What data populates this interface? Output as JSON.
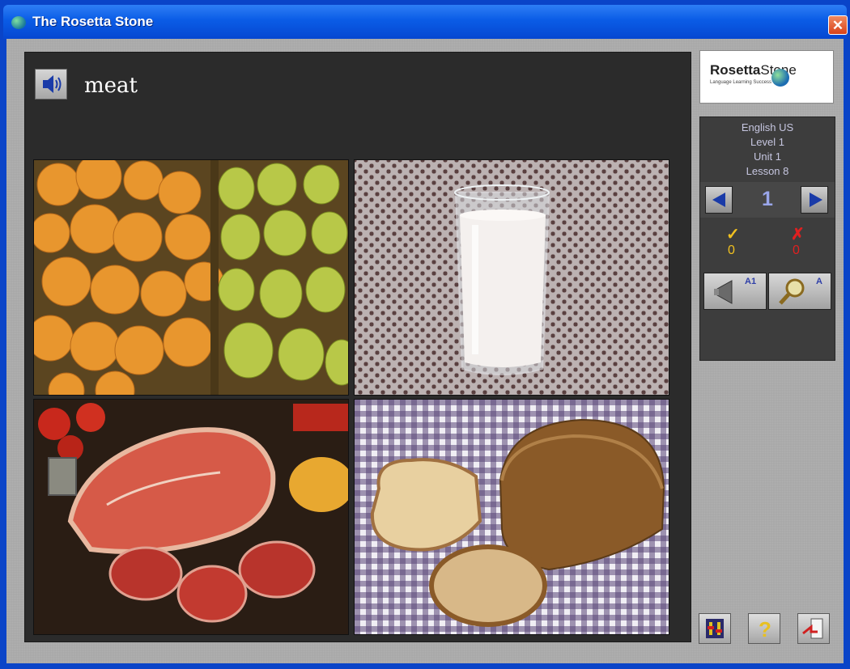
{
  "window": {
    "title": "The Rosetta Stone",
    "close_glyph": "✕"
  },
  "prompt": {
    "word": "meat",
    "speaker_icon": "speaker-icon"
  },
  "images": [
    {
      "name": "oranges-and-pears",
      "label": ""
    },
    {
      "name": "glass-of-milk",
      "label": ""
    },
    {
      "name": "raw-meat",
      "label": ""
    },
    {
      "name": "loaf-of-bread",
      "label": ""
    }
  ],
  "logo": {
    "text_bold": "Rosetta",
    "text_thin": "Stone",
    "tagline": "Language Learning Success"
  },
  "lesson_info": {
    "language": "English US",
    "level": "Level 1",
    "unit": "Unit 1",
    "lesson": "Lesson 8"
  },
  "navigation": {
    "page": "1"
  },
  "score": {
    "correct_glyph": "✓",
    "wrong_glyph": "✗",
    "correct": "0",
    "wrong": "0"
  },
  "modes": {
    "listen_label": "A1",
    "search_label": "A"
  },
  "colors": {
    "title_bar": "#0a5ce6",
    "stage": "#2b2b2b",
    "panel": "#3d3d3d",
    "accent_blue": "#1a3ba8",
    "correct": "#f0c020",
    "wrong": "#e02020"
  }
}
